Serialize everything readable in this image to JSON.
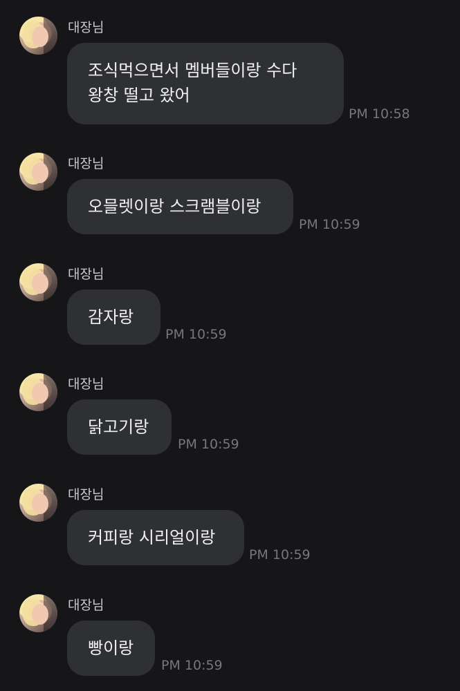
{
  "messages": [
    {
      "sender": "대장님",
      "text": "조식먹으면서 멤버들이랑 수다\n왕창 떨고 왔어",
      "time": "PM 10:58"
    },
    {
      "sender": "대장님",
      "text": "오믈렛이랑 스크램블이랑",
      "time": "PM 10:59"
    },
    {
      "sender": "대장님",
      "text": "감자랑",
      "time": "PM 10:59"
    },
    {
      "sender": "대장님",
      "text": "닭고기랑",
      "time": "PM 10:59"
    },
    {
      "sender": "대장님",
      "text": "커피랑 시리얼이랑",
      "time": "PM 10:59"
    },
    {
      "sender": "대장님",
      "text": "빵이랑",
      "time": "PM 10:59"
    }
  ],
  "colors": {
    "background": "#161619",
    "bubble": "#2f3034",
    "text": "#f1f1f3",
    "sender": "#c9cacd",
    "timestamp": "#76777c"
  },
  "icons": {
    "avatar": "profile-photo"
  }
}
